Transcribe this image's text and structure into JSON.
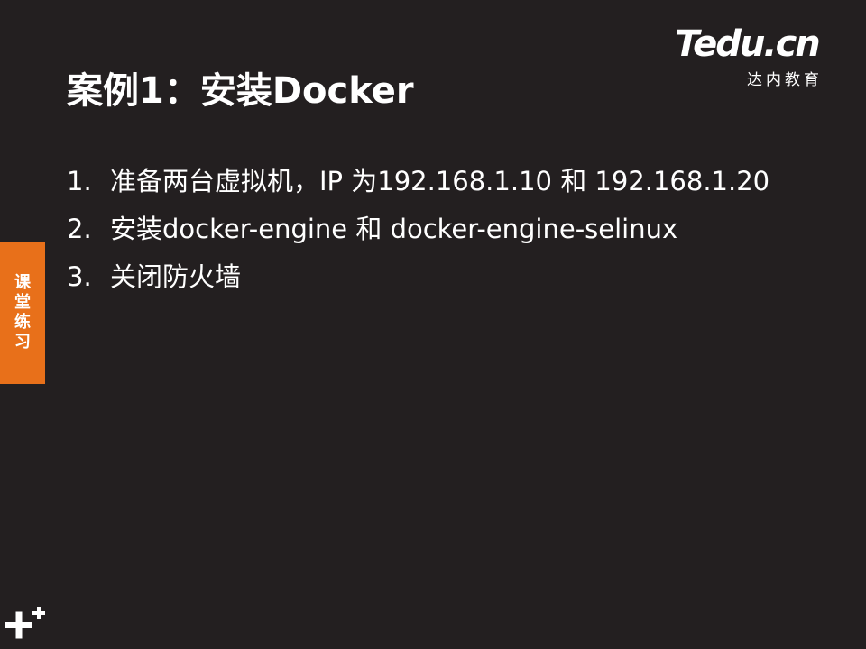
{
  "slide": {
    "title": "案例1：安装Docker",
    "logo": {
      "brand_text": "Tedu.cn",
      "subtitle": "达内教育"
    },
    "side_tab": {
      "label": "课堂练习"
    },
    "steps": [
      {
        "number": "1.",
        "text": "准备两台虚拟机，IP 为192.168.1.10 和 192.168.1.20"
      },
      {
        "number": "2.",
        "text": "安装docker-engine 和 docker-engine-selinux"
      },
      {
        "number": "3.",
        "text": "关闭防火墙"
      }
    ],
    "colors": {
      "background": "#231f20",
      "accent_orange": "#e8701a",
      "brand_pink": "#e8177f",
      "text": "#ffffff"
    },
    "icons": {
      "corner": "plus-icon"
    }
  }
}
